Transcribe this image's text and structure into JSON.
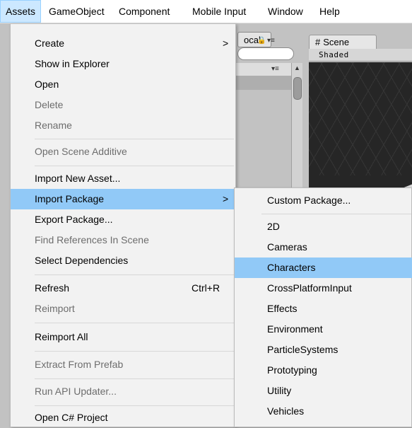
{
  "menubar": {
    "items": [
      "Assets",
      "GameObject",
      "Component",
      "Mobile Input",
      "Window",
      "Help"
    ]
  },
  "editor": {
    "local_label": "ocal",
    "scene_tab_icon": "#",
    "scene_tab_label": "Scene",
    "scene_toolbar_label": "Shaded"
  },
  "assets_menu": {
    "items": [
      {
        "label": "Create",
        "disabled": false,
        "submenu": true
      },
      {
        "label": "Show in Explorer",
        "disabled": false
      },
      {
        "label": "Open",
        "disabled": false
      },
      {
        "label": "Delete",
        "disabled": true
      },
      {
        "label": "Rename",
        "disabled": true
      },
      {
        "label": "Open Scene Additive",
        "disabled": true
      },
      {
        "label": "Import New Asset...",
        "disabled": false
      },
      {
        "label": "Import Package",
        "disabled": false,
        "submenu": true,
        "highlighted": true
      },
      {
        "label": "Export Package...",
        "disabled": false
      },
      {
        "label": "Find References In Scene",
        "disabled": true
      },
      {
        "label": "Select Dependencies",
        "disabled": false
      },
      {
        "label": "Refresh",
        "disabled": false,
        "shortcut": "Ctrl+R"
      },
      {
        "label": "Reimport",
        "disabled": true
      },
      {
        "label": "Reimport All",
        "disabled": false
      },
      {
        "label": "Extract From Prefab",
        "disabled": true
      },
      {
        "label": "Run API Updater...",
        "disabled": true
      },
      {
        "label": "Open C# Project",
        "disabled": false
      }
    ],
    "submenu_arrow": ">"
  },
  "import_package_submenu": {
    "items": [
      {
        "label": "Custom Package..."
      },
      {
        "label": "2D"
      },
      {
        "label": "Cameras"
      },
      {
        "label": "Characters",
        "highlighted": true
      },
      {
        "label": "CrossPlatformInput"
      },
      {
        "label": "Effects"
      },
      {
        "label": "Environment"
      },
      {
        "label": "ParticleSystems"
      },
      {
        "label": "Prototyping"
      },
      {
        "label": "Utility"
      },
      {
        "label": "Vehicles"
      }
    ]
  },
  "icons": {
    "lock": "lock-icon",
    "panel_menu": "panel-menu-icon",
    "scroll_up": "scroll-up-arrow-icon",
    "submenu_arrow": "chevron-right-icon",
    "scene": "scene-hash-icon"
  },
  "colors": {
    "highlight": "#91c9f7",
    "menubar_active": "#cce8ff",
    "disabled_text": "#6d6d6d",
    "menu_bg": "#f2f2f2"
  }
}
